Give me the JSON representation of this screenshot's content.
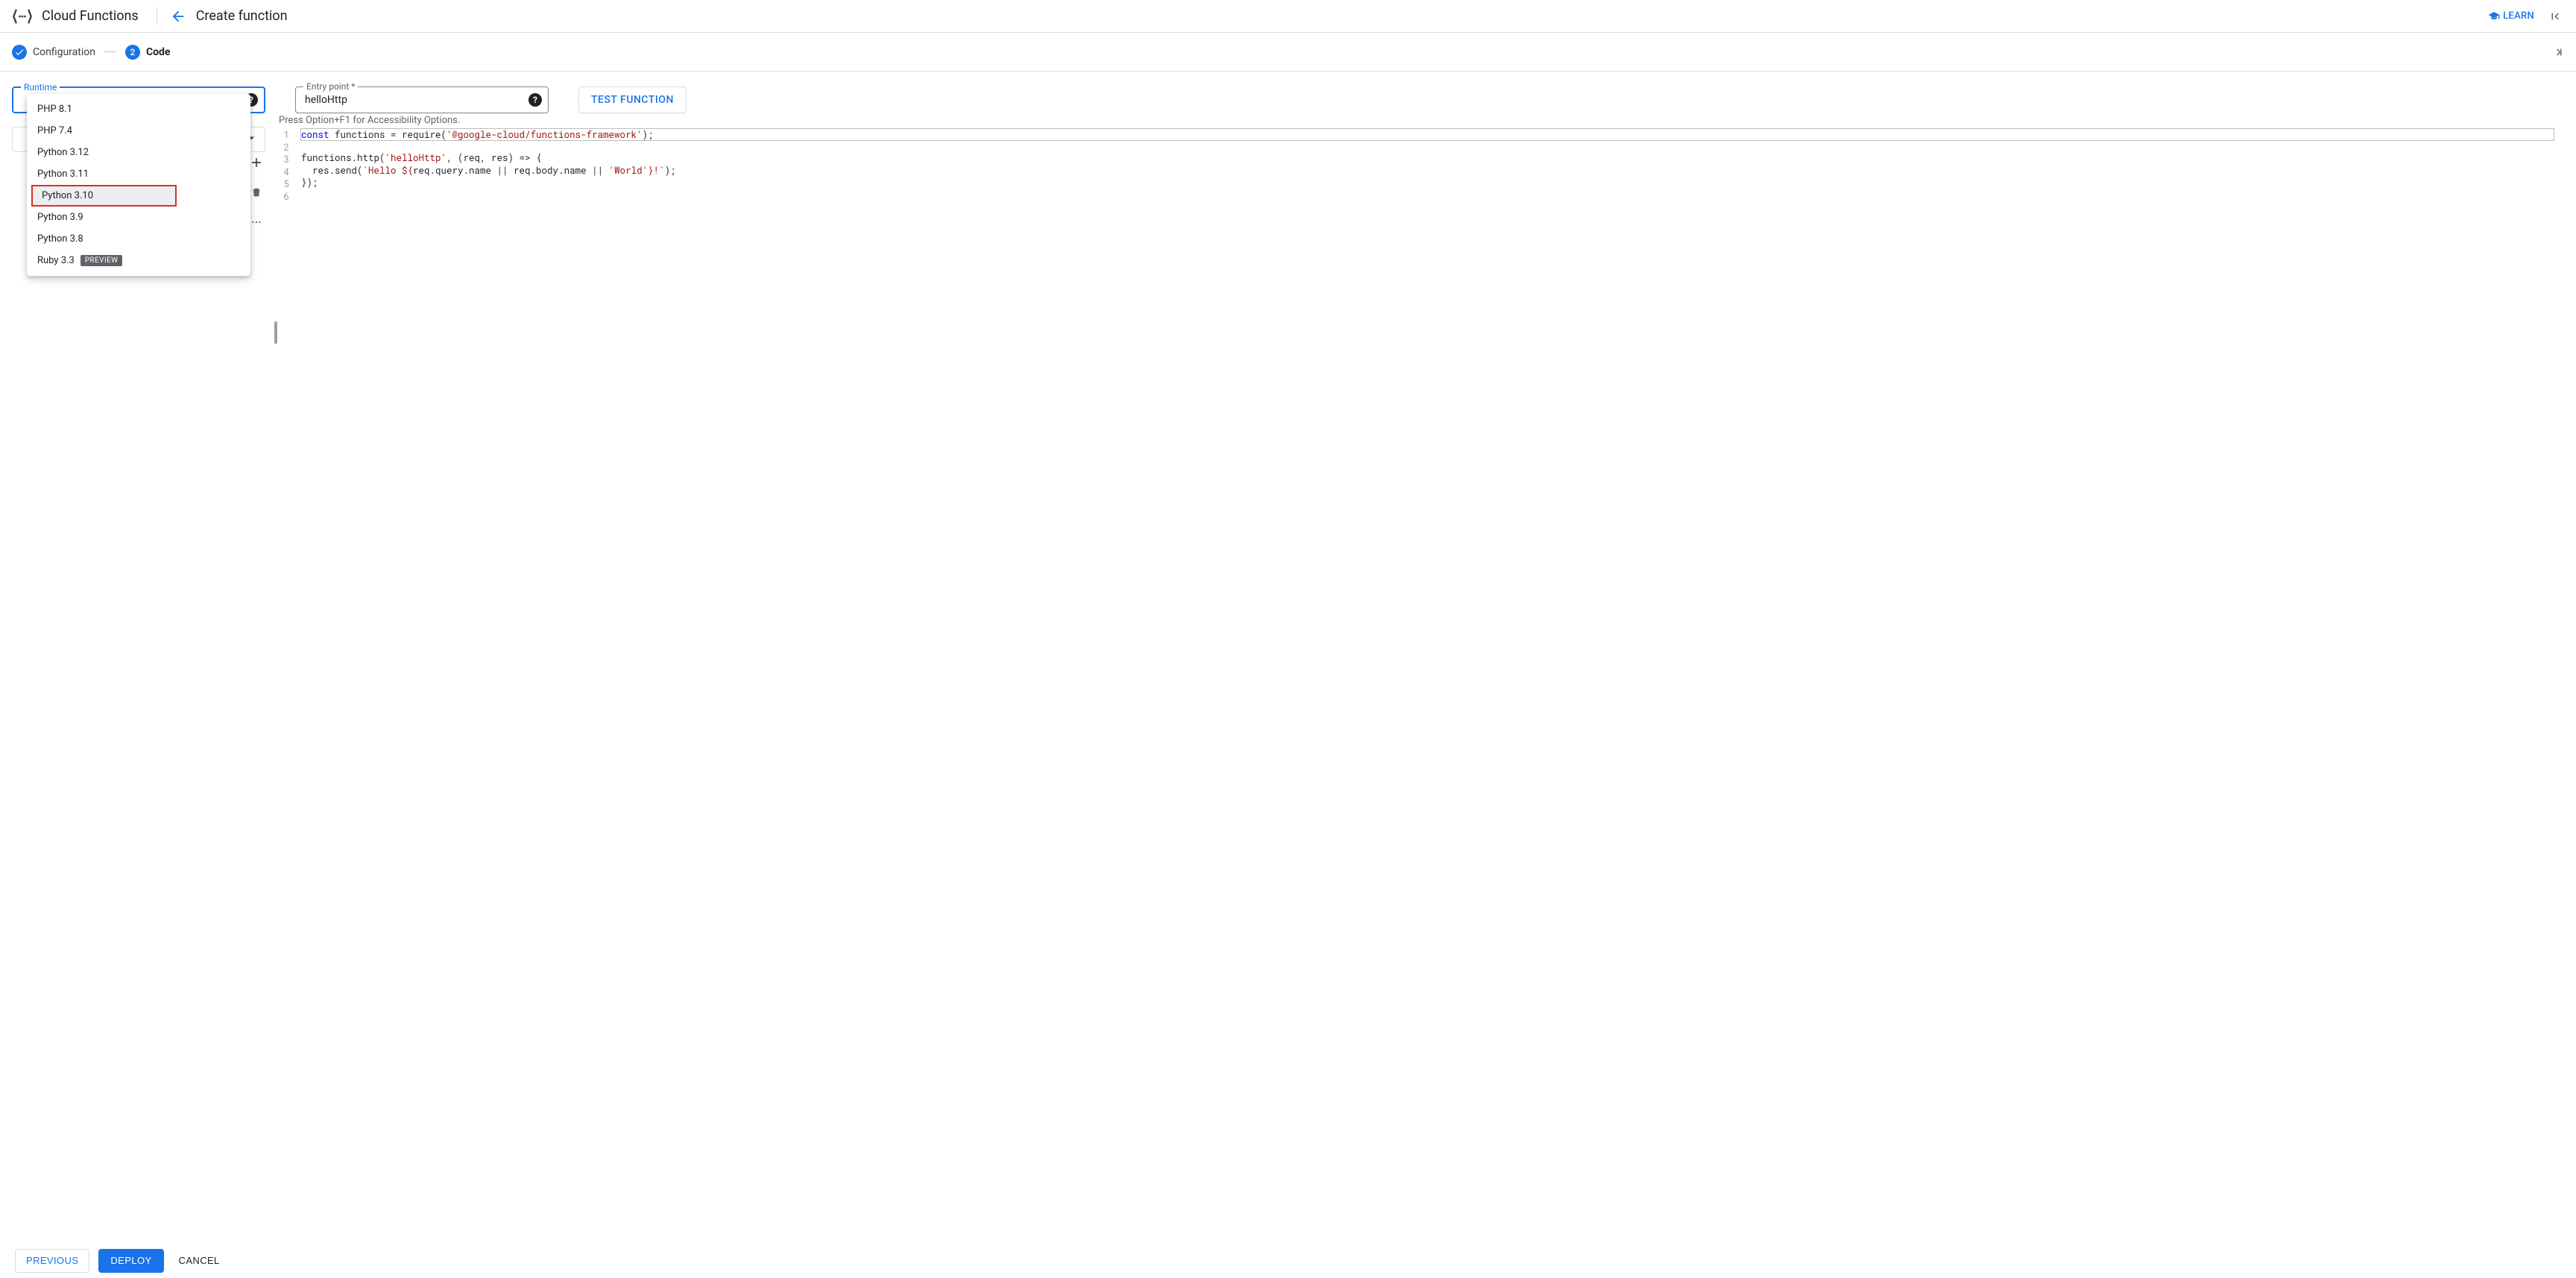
{
  "header": {
    "section_title": "Cloud Functions",
    "page_title": "Create function",
    "learn_label": "LEARN"
  },
  "stepper": {
    "step1_label": "Configuration",
    "step2_number": "2",
    "step2_label": "Code"
  },
  "fields": {
    "runtime_label": "Runtime",
    "entry_point_label": "Entry point *",
    "entry_point_value": "helloHttp",
    "test_button_label": "TEST FUNCTION"
  },
  "runtime_options": [
    {
      "label": "PHP 8.1",
      "highlighted": false,
      "hovered": false
    },
    {
      "label": "PHP 7.4",
      "highlighted": false,
      "hovered": false
    },
    {
      "label": "Python 3.12",
      "highlighted": false,
      "hovered": false
    },
    {
      "label": "Python 3.11",
      "highlighted": false,
      "hovered": false
    },
    {
      "label": "Python 3.10",
      "highlighted": true,
      "hovered": true
    },
    {
      "label": "Python 3.9",
      "highlighted": false,
      "hovered": false
    },
    {
      "label": "Python 3.8",
      "highlighted": false,
      "hovered": false
    },
    {
      "label": "Ruby 3.3",
      "highlighted": false,
      "hovered": false,
      "badge": "PREVIEW"
    }
  ],
  "editor": {
    "hint": "Press Option+F1 for Accessibility Options.",
    "line_numbers": [
      "1",
      "2",
      "3",
      "4",
      "5",
      "6"
    ],
    "line1": {
      "kw": "const",
      "a": " functions = require(",
      "str": "'@google-cloud/functions-framework'",
      "b": ");"
    },
    "line3": {
      "a": "functions.http(",
      "str": "'helloHttp'",
      "b": ", (req, res) => {"
    },
    "line4": {
      "a": "  res.send(",
      "s1": "`Hello ${",
      "mid": "req.query.name || req.body.name || ",
      "s2": "'World'",
      "s3": "}!`",
      "b": ");"
    },
    "line5": "});"
  },
  "footer": {
    "previous": "PREVIOUS",
    "deploy": "DEPLOY",
    "cancel": "CANCEL"
  }
}
